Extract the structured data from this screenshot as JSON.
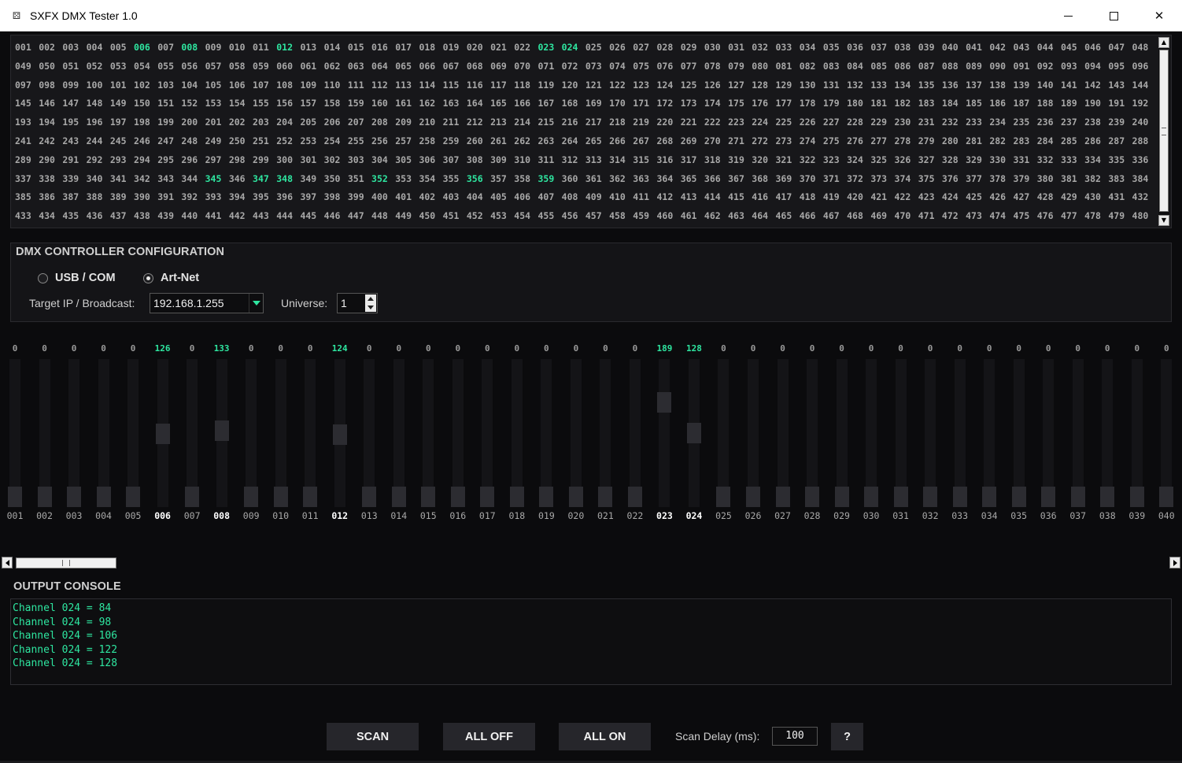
{
  "window": {
    "title": "SXFX DMX Tester 1.0",
    "minimize_glyph": "minimize-icon",
    "maximize_glyph": "maximize-icon",
    "close_glyph": "✕"
  },
  "grid": {
    "first_channel": 1,
    "last_channel": 480,
    "columns": 48,
    "active_channels": [
      6,
      8,
      12,
      23,
      24,
      345,
      347,
      348,
      352,
      356,
      359
    ]
  },
  "config": {
    "title": "DMX CONTROLLER CONFIGURATION",
    "mode_usb_label": "USB / COM",
    "mode_artnet_label": "Art-Net",
    "selected_mode": "Art-Net",
    "target_ip_label": "Target IP / Broadcast:",
    "target_ip_value": "192.168.1.255",
    "universe_label": "Universe:",
    "universe_value": "1"
  },
  "faders": [
    {
      "label": "001",
      "value": 0
    },
    {
      "label": "002",
      "value": 0
    },
    {
      "label": "003",
      "value": 0
    },
    {
      "label": "004",
      "value": 0
    },
    {
      "label": "005",
      "value": 0
    },
    {
      "label": "006",
      "value": 126
    },
    {
      "label": "007",
      "value": 0
    },
    {
      "label": "008",
      "value": 133
    },
    {
      "label": "009",
      "value": 0
    },
    {
      "label": "010",
      "value": 0
    },
    {
      "label": "011",
      "value": 0
    },
    {
      "label": "012",
      "value": 124
    },
    {
      "label": "013",
      "value": 0
    },
    {
      "label": "014",
      "value": 0
    },
    {
      "label": "015",
      "value": 0
    },
    {
      "label": "016",
      "value": 0
    },
    {
      "label": "017",
      "value": 0
    },
    {
      "label": "018",
      "value": 0
    },
    {
      "label": "019",
      "value": 0
    },
    {
      "label": "020",
      "value": 0
    },
    {
      "label": "021",
      "value": 0
    },
    {
      "label": "022",
      "value": 0
    },
    {
      "label": "023",
      "value": 189
    },
    {
      "label": "024",
      "value": 128
    },
    {
      "label": "025",
      "value": 0
    },
    {
      "label": "026",
      "value": 0
    },
    {
      "label": "027",
      "value": 0
    },
    {
      "label": "028",
      "value": 0
    },
    {
      "label": "029",
      "value": 0
    },
    {
      "label": "030",
      "value": 0
    },
    {
      "label": "031",
      "value": 0
    },
    {
      "label": "032",
      "value": 0
    },
    {
      "label": "033",
      "value": 0
    },
    {
      "label": "034",
      "value": 0
    },
    {
      "label": "035",
      "value": 0
    },
    {
      "label": "036",
      "value": 0
    },
    {
      "label": "037",
      "value": 0
    },
    {
      "label": "038",
      "value": 0
    },
    {
      "label": "039",
      "value": 0
    },
    {
      "label": "040",
      "value": 0
    }
  ],
  "fader_max": 255,
  "console": {
    "title": "OUTPUT CONSOLE",
    "lines": [
      "Channel 024 = 84",
      "Channel 024 = 98",
      "Channel 024 = 106",
      "Channel 024 = 122",
      "Channel 024 = 128"
    ]
  },
  "controls": {
    "scan_label": "SCAN",
    "all_off_label": "ALL OFF",
    "all_on_label": "ALL ON",
    "scan_delay_label": "Scan Delay (ms):",
    "scan_delay_value": "100",
    "help_label": "?"
  },
  "colors": {
    "accent": "#2ee6a0",
    "background": "#0b0b0d"
  }
}
